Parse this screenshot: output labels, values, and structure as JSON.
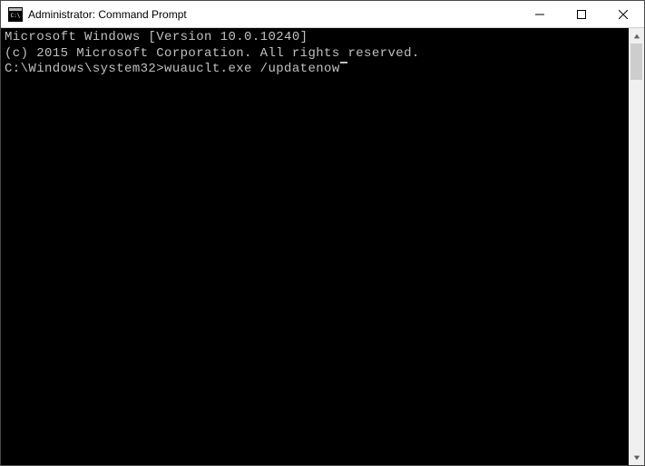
{
  "window": {
    "title": "Administrator: Command Prompt"
  },
  "terminal": {
    "line1": "Microsoft Windows [Version 10.0.10240]",
    "line2": "(c) 2015 Microsoft Corporation. All rights reserved.",
    "blank": "",
    "prompt": "C:\\Windows\\system32>",
    "command": "wuauclt.exe /updatenow"
  }
}
